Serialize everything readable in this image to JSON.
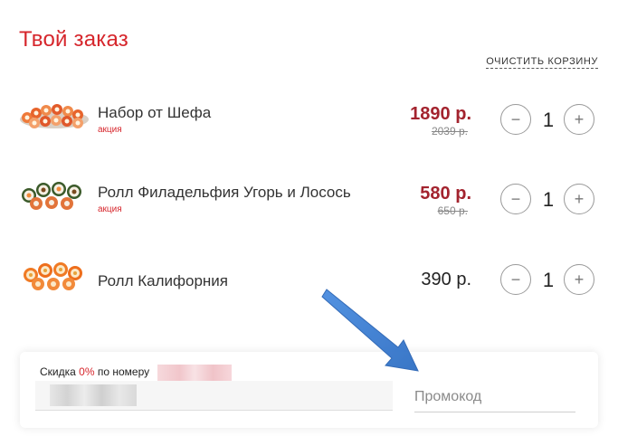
{
  "header": {
    "title": "Твой заказ",
    "clear_label": "ОЧИСТИТЬ КОРЗИНУ"
  },
  "items": [
    {
      "name": "Набор от Шефа",
      "tag": "акция",
      "price": "1890 р.",
      "old_price": "2039 р.",
      "quantity": "1",
      "minus": "−",
      "plus": "+",
      "thumb_icon": "sushi-set-icon"
    },
    {
      "name": "Ролл Филадельфия Угорь и Лосось",
      "tag": "акция",
      "price": "580 р.",
      "old_price": "650 р.",
      "quantity": "1",
      "minus": "−",
      "plus": "+",
      "thumb_icon": "sushi-roll-icon"
    },
    {
      "name": "Ролл Калифорния",
      "price": "390 р.",
      "quantity": "1",
      "minus": "−",
      "plus": "+",
      "thumb_icon": "sushi-roll-icon"
    }
  ],
  "discount": {
    "label_prefix": "Скидка",
    "percent": "0%",
    "label_suffix": "по номеру",
    "promo_placeholder": "Промокод"
  },
  "colors": {
    "accent": "#d6262c",
    "sale_price": "#a3232e",
    "arrow": "#3b7fd4"
  }
}
